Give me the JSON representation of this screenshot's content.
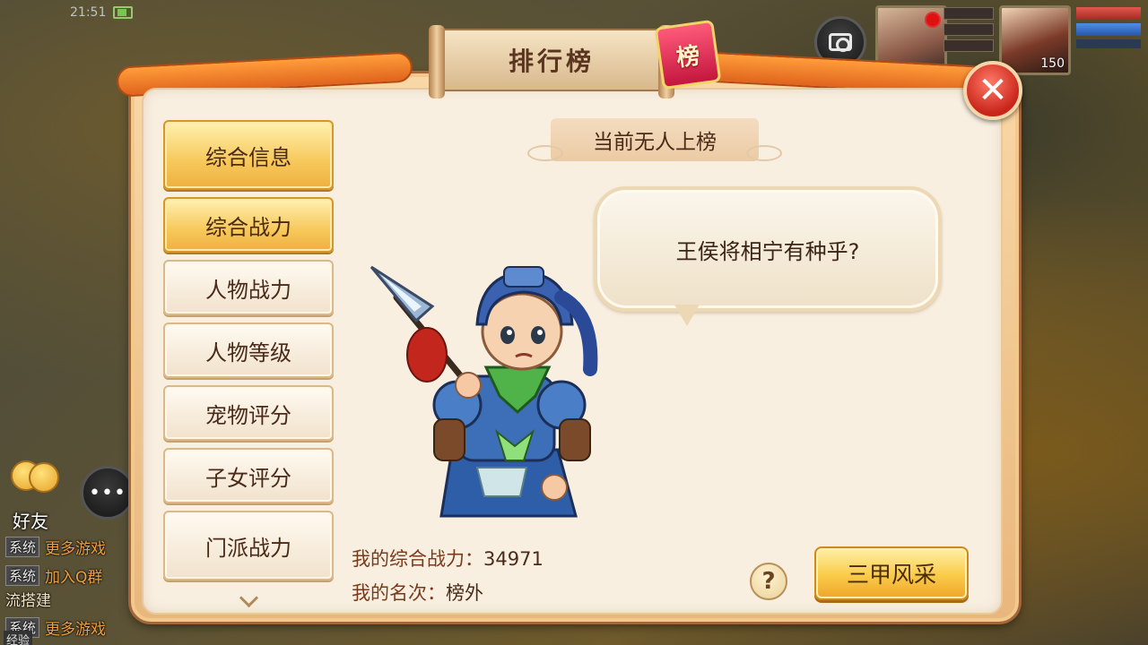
{
  "status_bar": {
    "time": "21:51"
  },
  "panel": {
    "title": "排行榜",
    "seal_char": "榜"
  },
  "close_symbol": "✕",
  "sidebar": {
    "items": [
      {
        "label": "综合信息",
        "active": true
      },
      {
        "label": "综合战力",
        "active": true
      },
      {
        "label": "人物战力",
        "active": false
      },
      {
        "label": "人物等级",
        "active": false
      },
      {
        "label": "宠物评分",
        "active": false
      },
      {
        "label": "子女评分",
        "active": false
      },
      {
        "label": "门派战力",
        "active": false
      }
    ]
  },
  "content": {
    "status": "当前无人上榜",
    "quote": "王侯将相宁有种乎?",
    "my_power_label": "我的综合战力：",
    "my_power_value": "34971",
    "my_rank_label": "我的名次：",
    "my_rank_value": "榜外",
    "help_symbol": "?",
    "action_button": "三甲风采"
  },
  "hud": {
    "hero_level": "150",
    "friends_label": "好友",
    "chat_icon": "•••",
    "chat": [
      {
        "tag": "系统",
        "text": "更多游戏"
      },
      {
        "tag": "系统",
        "text": "加入Q群"
      },
      {
        "tag": "",
        "text": "流搭建"
      },
      {
        "tag": "系统",
        "text": "更多游戏"
      }
    ],
    "exp_label": "经验"
  },
  "colors": {
    "panel_orange": "#f3c88c",
    "active_gold": "#f7c85b",
    "close_red": "#c8241a",
    "text_brown": "#4a2a18"
  },
  "icons": [
    "camera-icon",
    "close-icon",
    "help-icon",
    "chevron-down-icon",
    "chat-icon",
    "friends-icon"
  ]
}
